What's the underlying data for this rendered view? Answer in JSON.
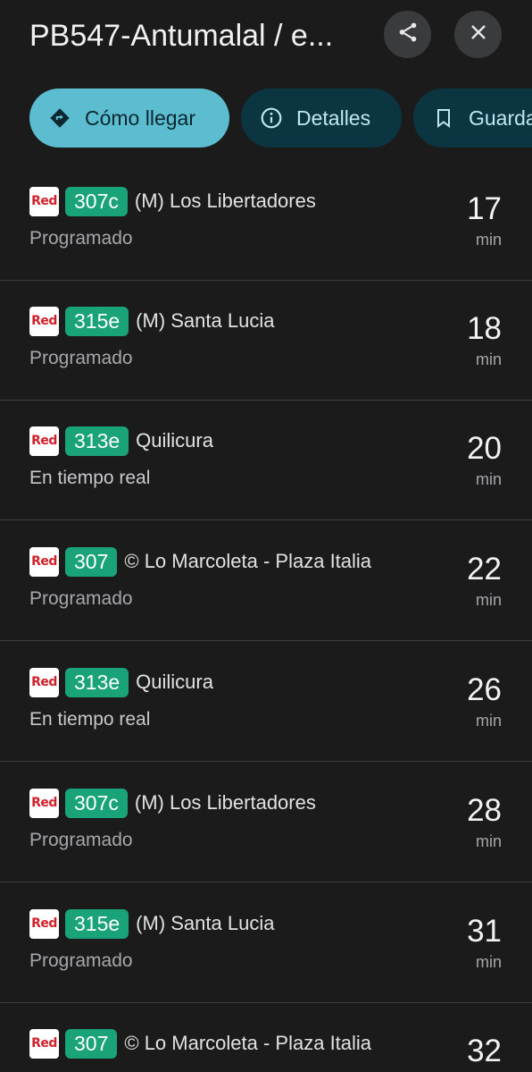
{
  "header": {
    "title": "PB547-Antumalal / e...",
    "share_icon": "share-icon",
    "close_icon": "close-icon"
  },
  "chips": [
    {
      "label": "Cómo llegar",
      "icon": "directions-icon"
    },
    {
      "label": "Detalles",
      "icon": "info-icon"
    },
    {
      "label": "Guardar",
      "icon": "bookmark-icon"
    }
  ],
  "colors": {
    "background": "#1b1b1c",
    "primary_chip": "#5cbcd0",
    "secondary_chip": "#0b3641",
    "route_badge": "#1aa378",
    "logo_text": "#d2202b"
  },
  "logo_text": "Red",
  "eta_unit": "min",
  "departures": [
    {
      "route": "307c",
      "destination": "(M) Los Libertadores",
      "status": "Programado",
      "eta": "17"
    },
    {
      "route": "315e",
      "destination": "(M) Santa Lucia",
      "status": "Programado",
      "eta": "18"
    },
    {
      "route": "313e",
      "destination": "Quilicura",
      "status": "En tiempo real",
      "eta": "20"
    },
    {
      "route": "307",
      "destination": "© Lo Marcoleta - Plaza Italia",
      "status": "Programado",
      "eta": "22"
    },
    {
      "route": "313e",
      "destination": "Quilicura",
      "status": "En tiempo real",
      "eta": "26"
    },
    {
      "route": "307c",
      "destination": "(M) Los Libertadores",
      "status": "Programado",
      "eta": "28"
    },
    {
      "route": "315e",
      "destination": "(M) Santa Lucia",
      "status": "Programado",
      "eta": "31"
    },
    {
      "route": "307",
      "destination": "© Lo Marcoleta - Plaza Italia",
      "status": "",
      "eta": "32"
    }
  ]
}
